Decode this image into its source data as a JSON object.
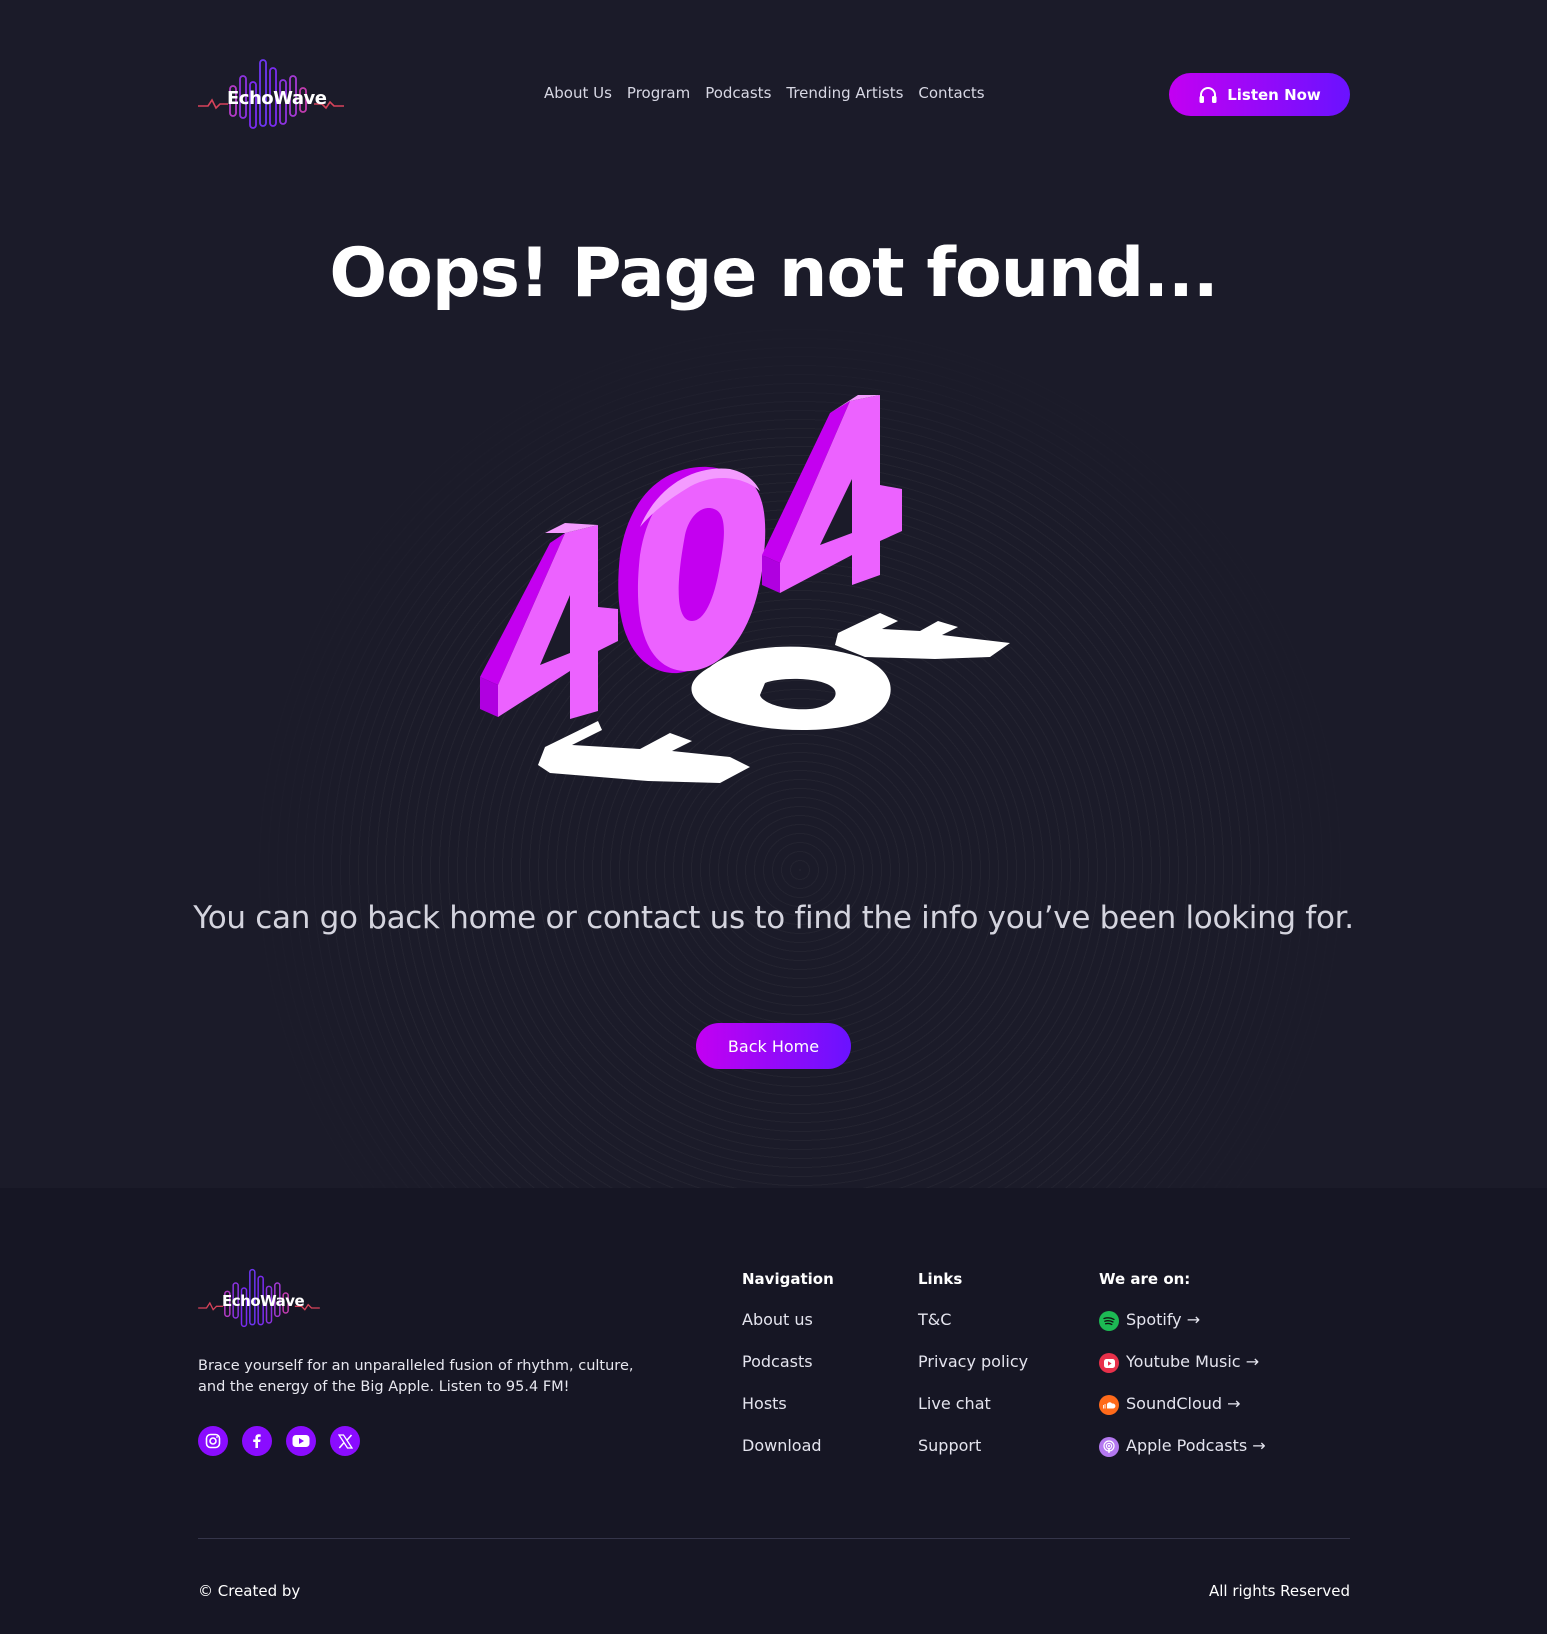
{
  "brand": {
    "name": "EchoWave"
  },
  "nav": {
    "items": [
      "About Us",
      "Program",
      "Podcasts",
      "Trending Artists",
      "Contacts"
    ]
  },
  "header": {
    "cta_label": "Listen Now",
    "cta_icon": "headphones-icon"
  },
  "main": {
    "title": "Oops! Page not found...",
    "illustration_text": "404",
    "subtitle": "You can go back home or contact us to find the info you’ve been looking for.",
    "back_button": "Back Home"
  },
  "footer": {
    "description": "Brace yourself for an unparalleled fusion of rhythm, culture, and the energy of the Big Apple. Listen to 95.4 FM!",
    "socials": [
      "instagram-icon",
      "facebook-icon",
      "youtube-icon",
      "x-icon"
    ],
    "navigation": {
      "heading": "Navigation",
      "items": [
        "About us",
        "Podcasts",
        "Hosts",
        "Download"
      ]
    },
    "links": {
      "heading": "Links",
      "items": [
        "T&C",
        "Privacy policy",
        "Live chat",
        "Support"
      ]
    },
    "platforms": {
      "heading": "We are on:",
      "items": [
        "Spotify →",
        "Youtube Music →",
        "SoundCloud →",
        "Apple Podcasts →"
      ]
    },
    "credit": "© Created by",
    "rights": "All rights Reserved"
  },
  "colors": {
    "background": "#1b1b29",
    "footer": "#161624",
    "accent_start": "#c300f2",
    "accent_end": "#6a12ff",
    "pink": "#ea65ff",
    "spotify": "#1db954",
    "youtube": "#e8304a",
    "soundcloud": "#ff6a1a",
    "apple_podcasts": "#b478f0"
  }
}
